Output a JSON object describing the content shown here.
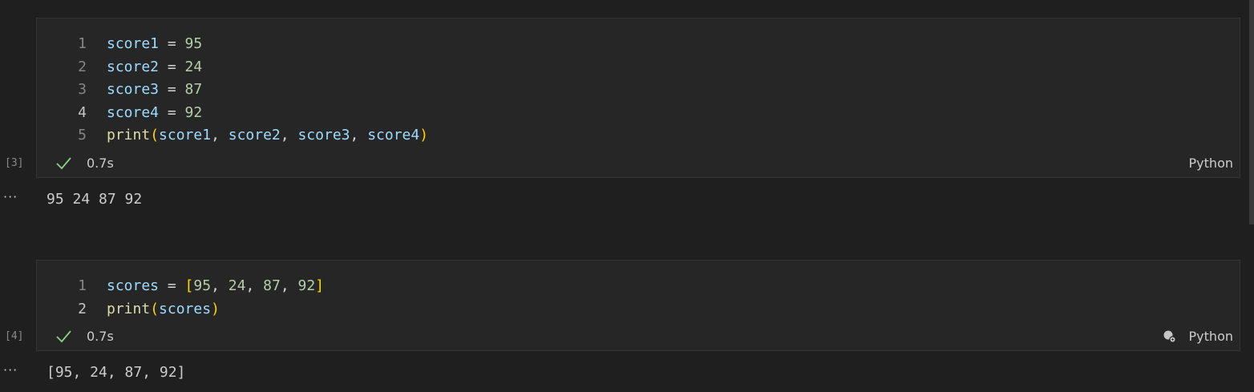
{
  "cells": [
    {
      "exec_count": "[3]",
      "lines": [
        {
          "num": "1",
          "tokens": [
            [
              "var",
              "score1"
            ],
            [
              "op",
              " = "
            ],
            [
              "num",
              "95"
            ]
          ]
        },
        {
          "num": "2",
          "tokens": [
            [
              "var",
              "score2"
            ],
            [
              "op",
              " = "
            ],
            [
              "num",
              "24"
            ]
          ]
        },
        {
          "num": "3",
          "tokens": [
            [
              "var",
              "score3"
            ],
            [
              "op",
              " = "
            ],
            [
              "num",
              "87"
            ]
          ]
        },
        {
          "num": "4",
          "tokens": [
            [
              "var",
              "score4"
            ],
            [
              "op",
              " = "
            ],
            [
              "num",
              "92"
            ]
          ]
        },
        {
          "num": "5",
          "tokens": [
            [
              "fn",
              "print"
            ],
            [
              "paren",
              "("
            ],
            [
              "var",
              "score1"
            ],
            [
              "punc",
              ", "
            ],
            [
              "var",
              "score2"
            ],
            [
              "punc",
              ", "
            ],
            [
              "var",
              "score3"
            ],
            [
              "punc",
              ", "
            ],
            [
              "var",
              "score4"
            ],
            [
              "paren",
              ")"
            ]
          ]
        }
      ],
      "duration": "0.7s",
      "language": "Python",
      "output": "95 24 87 92"
    },
    {
      "exec_count": "[4]",
      "lines": [
        {
          "num": "1",
          "tokens": [
            [
              "var",
              "scores"
            ],
            [
              "op",
              " = "
            ],
            [
              "paren",
              "["
            ],
            [
              "num",
              "95"
            ],
            [
              "punc",
              ", "
            ],
            [
              "num",
              "24"
            ],
            [
              "punc",
              ", "
            ],
            [
              "num",
              "87"
            ],
            [
              "punc",
              ", "
            ],
            [
              "num",
              "92"
            ],
            [
              "paren",
              "]"
            ]
          ]
        },
        {
          "num": "2",
          "tokens": [
            [
              "fn",
              "print"
            ],
            [
              "paren",
              "("
            ],
            [
              "var",
              "scores"
            ],
            [
              "paren",
              ")"
            ]
          ]
        }
      ],
      "duration": "0.7s",
      "language": "Python",
      "output": "[95, 24, 87, 92]"
    }
  ],
  "ellipsis": "···",
  "colors": {
    "background": "#1f1f1f",
    "cell_background": "#262626",
    "success_check": "#89d185",
    "variable": "#9cdcfe",
    "number": "#b5cea8",
    "function": "#dcdcaa",
    "bracket": "#ffd700"
  },
  "icons": {
    "success": "check-icon",
    "kernel": "kernel-status-icon"
  }
}
